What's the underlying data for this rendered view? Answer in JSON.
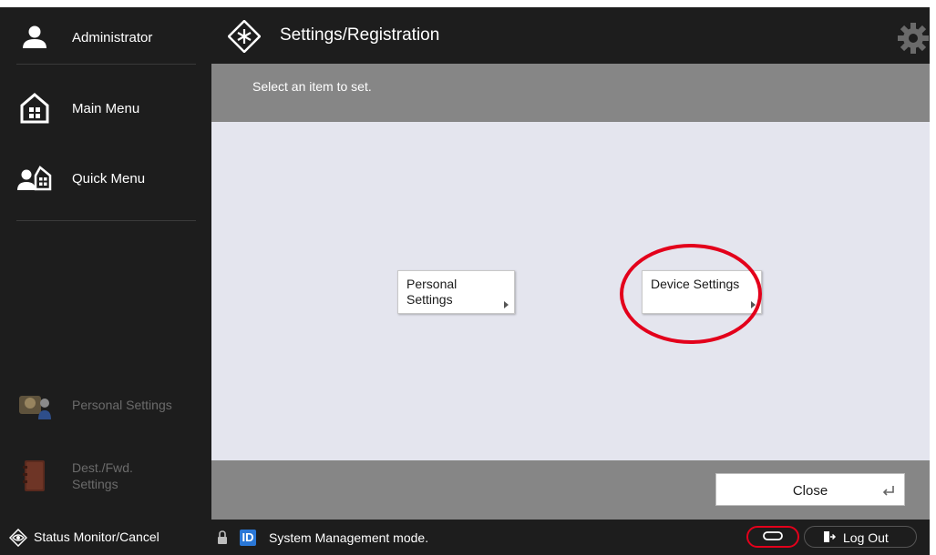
{
  "sidebar": {
    "user": "Administrator",
    "items": [
      {
        "label": "Main Menu",
        "icon": "home-icon"
      },
      {
        "label": "Quick Menu",
        "icon": "quick-menu-icon"
      }
    ],
    "shortcuts": [
      {
        "label": "Personal Settings",
        "icon": "personal-settings-icon"
      },
      {
        "label": "Dest./Fwd. Settings",
        "icon": "address-book-icon"
      }
    ]
  },
  "header": {
    "title": "Settings/Registration",
    "icon": "settings-registration-icon",
    "right_icon": "gear-icon"
  },
  "instruction": "Select an item to set.",
  "tiles": [
    {
      "label": "Personal Settings"
    },
    {
      "label": "Device Settings"
    }
  ],
  "actions": {
    "close_label": "Close"
  },
  "statusbar": {
    "status_monitor": "Status Monitor/Cancel",
    "id_badge": "ID",
    "mode": "System Management mode.",
    "logout": "Log Out"
  },
  "colors": {
    "bar_dark": "#1d1d1d",
    "bar_gray": "#868686",
    "content_bg": "#e4e5ee",
    "highlight": "#e3001b",
    "id_blue": "#2a77d6"
  }
}
